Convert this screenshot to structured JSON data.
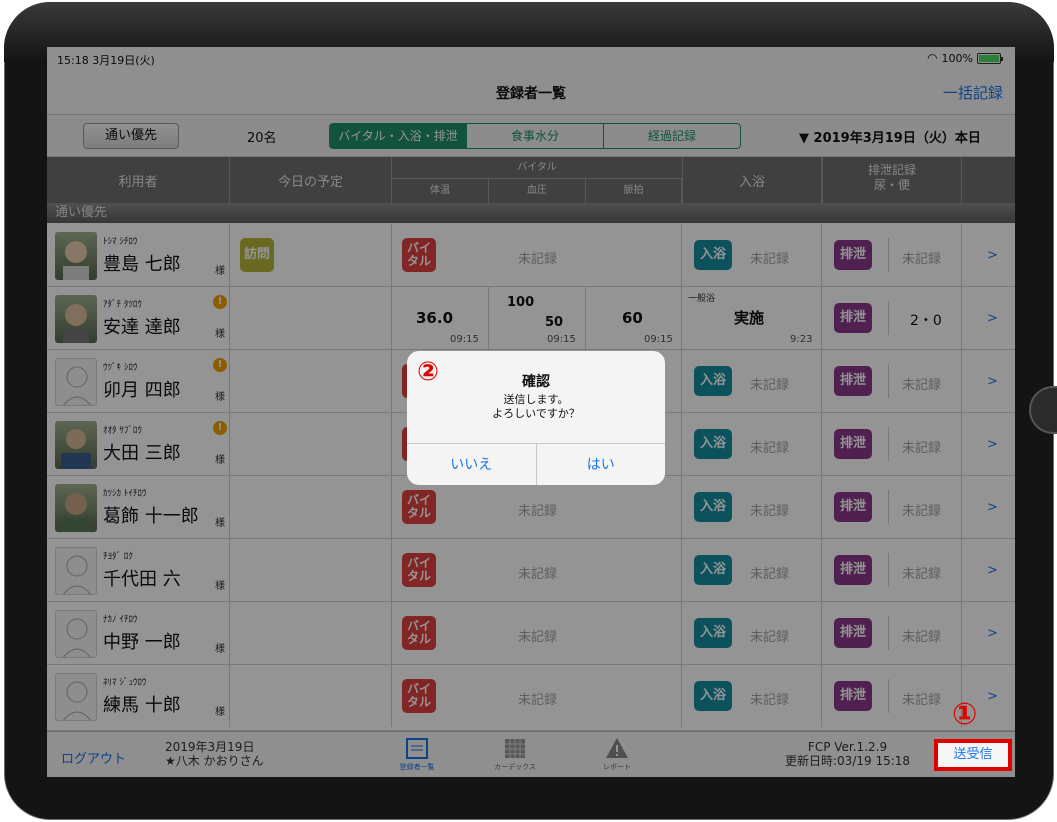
{
  "status_bar": {
    "time": "15:18 3月19日(火)",
    "battery": "100%"
  },
  "nav": {
    "title": "登録者一覧",
    "bulk_record": "一括記録"
  },
  "filter": {
    "priority_button": "通い優先",
    "count": "20名",
    "segments": [
      "バイタル・入浴・排泄",
      "食事水分",
      "経過記録"
    ],
    "date": "▼ 2019年3月19日（火）本日"
  },
  "table_header": {
    "user": "利用者",
    "schedule": "今日の予定",
    "vital": "バイタル",
    "temp": "体温",
    "bp": "血圧",
    "pulse": "脈拍",
    "bath": "入浴",
    "excretion": "排泄記録",
    "excretion_sub": "尿・便"
  },
  "section_label": "通い優先",
  "labels": {
    "sama": "様",
    "unrecorded": "未記録",
    "visit": "訪問",
    "vital_badge": "バイ\nタル",
    "bath_badge": "入浴",
    "excr_badge": "排泄",
    "chevron": ">"
  },
  "rows": [
    {
      "kana": "ﾄｼﾏ ｼﾁﾛｳ",
      "name": "豊島 七郎",
      "alert": false,
      "visit": true
    },
    {
      "kana": "ｱﾀﾞﾁ ﾀﾂﾛｳ",
      "name": "安達 達郎",
      "alert": true,
      "temp": "36.0",
      "temp_time": "09:15",
      "bp_high": "100",
      "bp_low": "50",
      "bp_time": "09:15",
      "pulse": "60",
      "pulse_time": "09:15",
      "bath_kind": "一般浴",
      "bath_status": "実施",
      "bath_time": "9:23",
      "excretion": "2・0"
    },
    {
      "kana": "ｳﾂﾞｷ ｼﾛｳ",
      "name": "卯月 四郎",
      "alert": true
    },
    {
      "kana": "ｵｵﾀ ｻﾌﾞﾛｳ",
      "name": "大田 三郎",
      "alert": true
    },
    {
      "kana": "ｶﾂｼｶ ﾄｲﾁﾛｳ",
      "name": "葛飾 十一郎",
      "alert": false
    },
    {
      "kana": "ﾁﾖﾀﾞ ﾛｸ",
      "name": "千代田 六",
      "alert": false
    },
    {
      "kana": "ﾅｶﾉ ｲﾁﾛｳ",
      "name": "中野 一郎",
      "alert": false
    },
    {
      "kana": "ﾈﾘﾏ ｼﾞｭｳﾛｳ",
      "name": "練馬 十郎",
      "alert": false
    }
  ],
  "dialog": {
    "step": "②",
    "title": "確認",
    "message_line1": "送信します。",
    "message_line2": "よろしいですか？",
    "no": "いいえ",
    "yes": "はい"
  },
  "toolbar": {
    "logout": "ログアウト",
    "date": "2019年3月19日",
    "user": "★八木 かおりさん",
    "tabs": [
      "登録者一覧",
      "カーデックス",
      "レポート"
    ],
    "version": "FCP Ver.1.2.9",
    "updated": "更新日時:03/19 15:18",
    "send": "送受信",
    "step": "①"
  }
}
